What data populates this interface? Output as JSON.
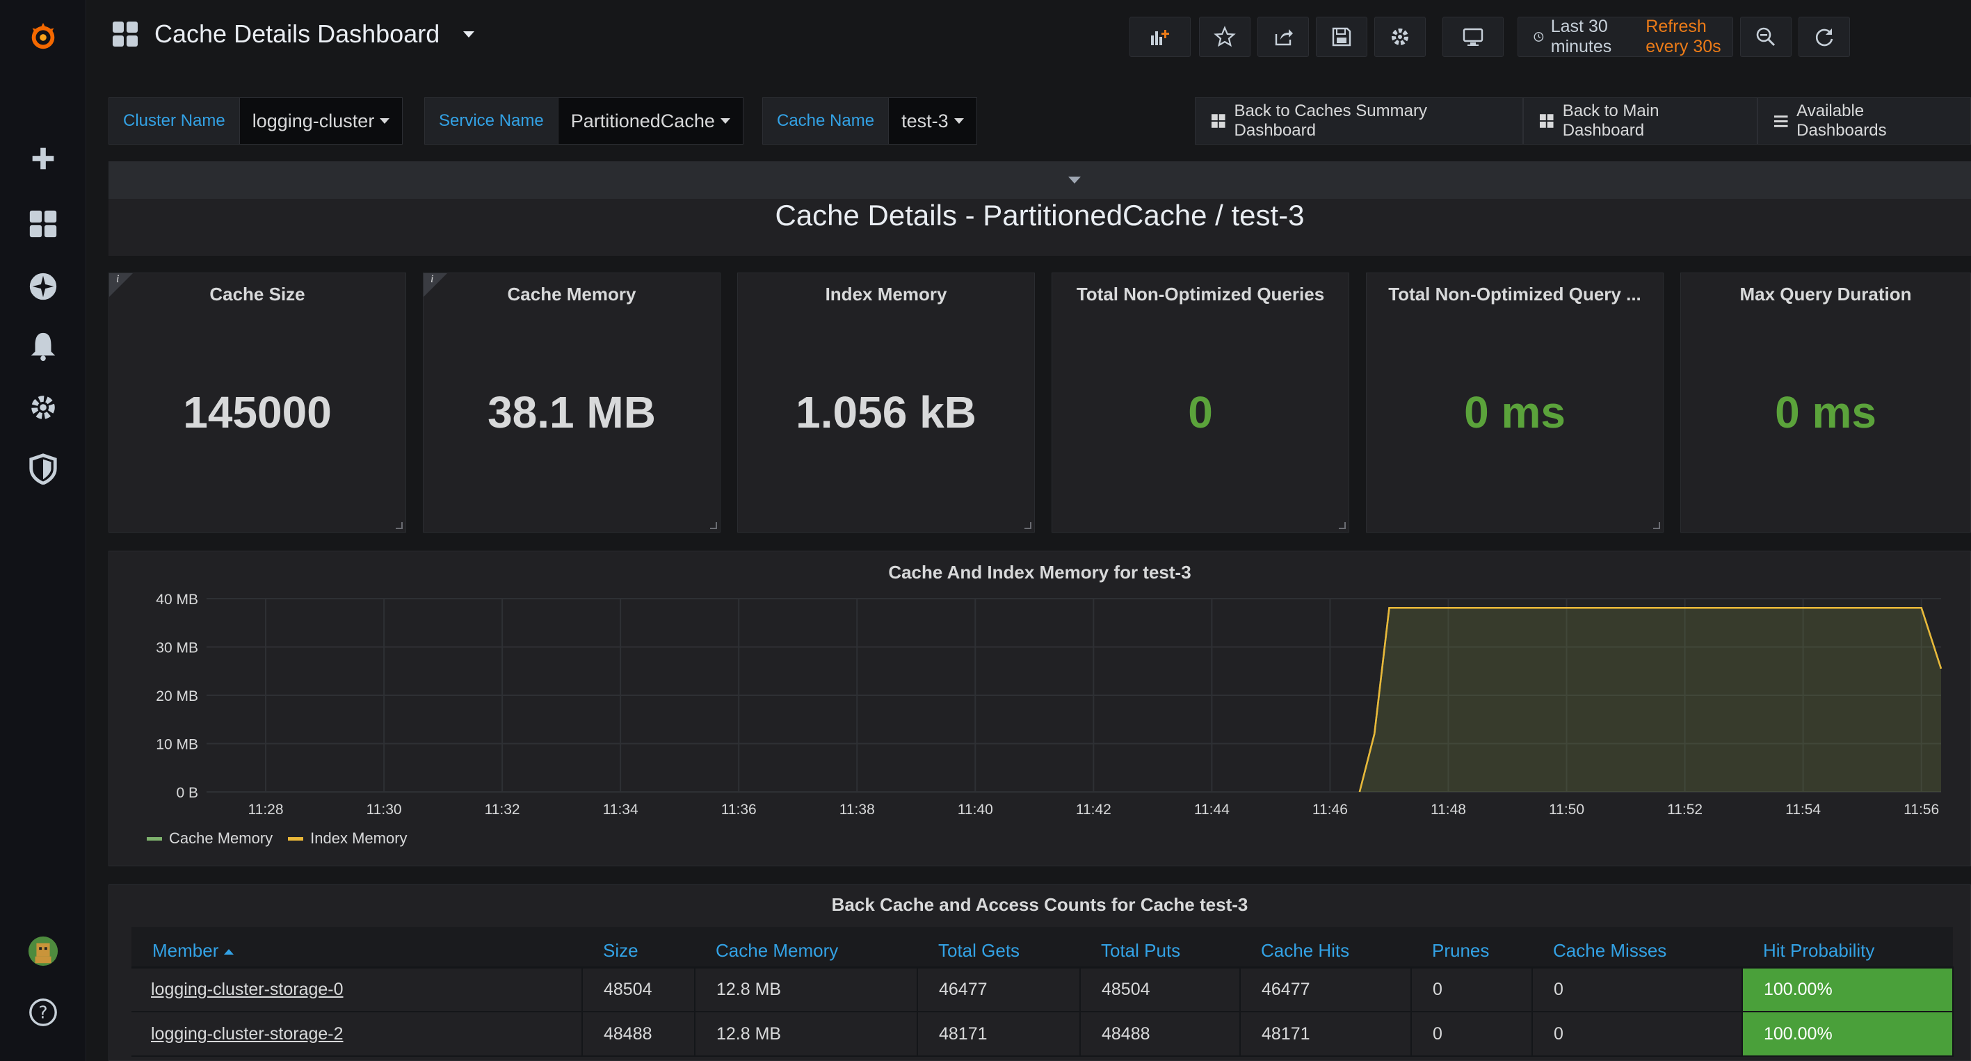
{
  "dashboard": {
    "title": "Cache Details Dashboard"
  },
  "time": {
    "range": "Last 30 minutes",
    "refresh": "Refresh every 30s"
  },
  "variables": [
    {
      "label": "Cluster Name",
      "value": "logging-cluster"
    },
    {
      "label": "Service Name",
      "value": "PartitionedCache"
    },
    {
      "label": "Cache Name",
      "value": "test-3"
    }
  ],
  "links": [
    {
      "label": "Back to Caches Summary Dashboard"
    },
    {
      "label": "Back to Main Dashboard"
    },
    {
      "label": "Available Dashboards"
    }
  ],
  "heading": "Cache Details - PartitionedCache / test-3",
  "stats": [
    {
      "title": "Cache Size",
      "value": "145000",
      "color": "#d8d9da",
      "info": "i"
    },
    {
      "title": "Cache Memory",
      "value": "38.1 MB",
      "color": "#d8d9da",
      "info": "i"
    },
    {
      "title": "Index Memory",
      "value": "1.056 kB",
      "color": "#d8d9da"
    },
    {
      "title": "Total Non-Optimized Queries",
      "value": "0",
      "color": "#5ba33b"
    },
    {
      "title": "Total Non-Optimized Query ...",
      "value": "0 ms",
      "color": "#5ba33b"
    },
    {
      "title": "Max Query Duration",
      "value": "0 ms",
      "color": "#5ba33b"
    }
  ],
  "chart_data": {
    "type": "area",
    "title": "Cache And Index Memory for test-3",
    "x": [
      "11:27:00",
      "11:46:30",
      "11:46:45",
      "11:47:00",
      "11:47:30",
      "11:48",
      "11:50",
      "11:52",
      "11:54",
      "11:56:00",
      "11:56:20"
    ],
    "x_ticks": [
      "11:28",
      "11:30",
      "11:32",
      "11:34",
      "11:36",
      "11:38",
      "11:40",
      "11:42",
      "11:44",
      "11:46",
      "11:48",
      "11:50",
      "11:52",
      "11:54",
      "11:56"
    ],
    "y_ticks": [
      "40 MB",
      "30 MB",
      "20 MB",
      "10 MB",
      "0 B"
    ],
    "ylim": [
      0,
      40
    ],
    "series": [
      {
        "name": "Cache Memory",
        "color": "#7eb26d",
        "values": [
          null,
          0,
          12,
          38.1,
          38.1,
          38.1,
          38.1,
          38.1,
          38.1,
          38.1,
          25.5
        ]
      },
      {
        "name": "Index Memory",
        "color": "#eab839",
        "values": [
          null,
          0,
          12,
          38.1,
          38.1,
          38.1,
          38.1,
          38.1,
          38.1,
          38.1,
          25.5
        ]
      }
    ],
    "legend": "bottom-left",
    "grid": true
  },
  "table": {
    "title": "Back Cache and Access Counts for Cache test-3",
    "columns": [
      "Member",
      "Size",
      "Cache Memory",
      "Total Gets",
      "Total Puts",
      "Cache Hits",
      "Prunes",
      "Cache Misses",
      "Hit Probability"
    ],
    "rows": [
      [
        "logging-cluster-storage-0",
        "48504",
        "12.8 MB",
        "46477",
        "48504",
        "46477",
        "0",
        "0",
        "100.00%"
      ],
      [
        "logging-cluster-storage-2",
        "48488",
        "12.8 MB",
        "48171",
        "48488",
        "48171",
        "0",
        "0",
        "100.00%"
      ]
    ]
  }
}
